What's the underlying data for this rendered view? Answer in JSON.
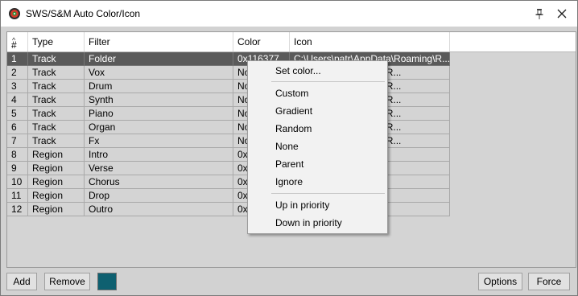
{
  "window": {
    "title": "SWS/S&M Auto Color/Icon"
  },
  "columns": [
    "#",
    "Type",
    "Filter",
    "Color",
    "Icon"
  ],
  "rows": [
    {
      "num": "1",
      "type": "Track",
      "filter": "Folder",
      "color": "0x116377",
      "icon": "C:\\Users\\patr\\AppData\\Roaming\\R..."
    },
    {
      "num": "2",
      "type": "Track",
      "filter": "Vox",
      "color": "None",
      "icon": "...\\AppData\\Roaming\\R..."
    },
    {
      "num": "3",
      "type": "Track",
      "filter": "Drum",
      "color": "None",
      "icon": "...\\AppData\\Roaming\\R..."
    },
    {
      "num": "4",
      "type": "Track",
      "filter": "Synth",
      "color": "None",
      "icon": "...\\AppData\\Roaming\\R..."
    },
    {
      "num": "5",
      "type": "Track",
      "filter": "Piano",
      "color": "None",
      "icon": "...\\AppData\\Roaming\\R..."
    },
    {
      "num": "6",
      "type": "Track",
      "filter": "Organ",
      "color": "None",
      "icon": "...\\AppData\\Roaming\\R..."
    },
    {
      "num": "7",
      "type": "Track",
      "filter": "Fx",
      "color": "None",
      "icon": "...\\AppData\\Roaming\\R..."
    },
    {
      "num": "8",
      "type": "Region",
      "filter": "Intro",
      "color": "0x",
      "icon": ""
    },
    {
      "num": "9",
      "type": "Region",
      "filter": "Verse",
      "color": "0x",
      "icon": ""
    },
    {
      "num": "10",
      "type": "Region",
      "filter": "Chorus",
      "color": "0x",
      "icon": ""
    },
    {
      "num": "11",
      "type": "Region",
      "filter": "Drop",
      "color": "0x",
      "icon": ""
    },
    {
      "num": "12",
      "type": "Region",
      "filter": "Outro",
      "color": "0x",
      "icon": ""
    }
  ],
  "selected_row": 1,
  "buttons": {
    "add": "Add",
    "remove": "Remove",
    "options": "Options",
    "force": "Force"
  },
  "swatch_color": "#0e6070",
  "context_menu": {
    "items": [
      "Set color...",
      "Custom",
      "Gradient",
      "Random",
      "None",
      "Parent",
      "Ignore",
      "Up in priority",
      "Down in priority"
    ]
  },
  "icons": {
    "app": "reaper-logo-icon",
    "pin": "pin-icon",
    "close": "close-icon",
    "sort": "sort-ascending-icon"
  }
}
